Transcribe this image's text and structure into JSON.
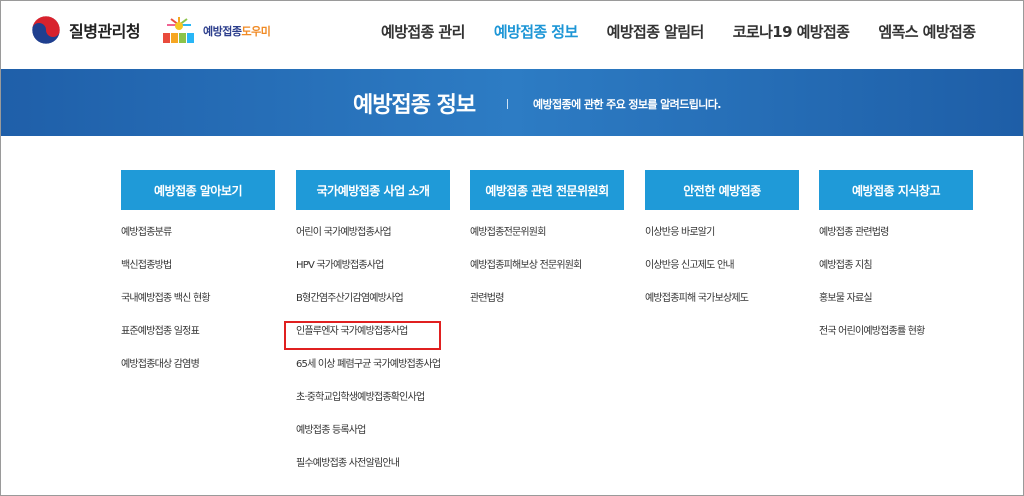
{
  "header": {
    "kdca_name": "질병관리청",
    "nip_name_main": "예방접종",
    "nip_name_accent": "도우미",
    "nav": [
      {
        "label": "예방접종 관리"
      },
      {
        "label": "예방접종 정보"
      },
      {
        "label": "예방접종 알림터"
      },
      {
        "label": "코로나19 예방접종"
      },
      {
        "label": "엠폭스 예방접종"
      }
    ],
    "active_index": 1
  },
  "banner": {
    "title": "예방접종 정보",
    "description": "예방접종에 관한 주요 정보를 알려드립니다."
  },
  "columns": [
    {
      "title": "예방접종 알아보기",
      "items": [
        "예방접종분류",
        "백신접종방법",
        "국내예방접종 백신 현황",
        "표준예방접종 일정표",
        "예방접종대상 감염병"
      ]
    },
    {
      "title": "국가예방접종 사업 소개",
      "items": [
        "어린이 국가예방접종사업",
        "HPV 국가예방접종사업",
        "B형간염주산기감염예방사업",
        "인플루엔자 국가예방접종사업",
        "65세 이상 폐렴구균 국가예방접종사업",
        "초·중학교입학생예방접종확인사업",
        "예방접종 등록사업",
        "필수예방접종 사전알림안내"
      ]
    },
    {
      "title": "예방접종 관련 전문위원회",
      "items": [
        "예방접종전문위원회",
        "예방접종피해보상 전문위원회",
        "관련법령"
      ]
    },
    {
      "title": "안전한 예방접종",
      "items": [
        "이상반응 바로알기",
        "이상반응 신고제도 안내",
        "예방접종피해 국가보상제도"
      ]
    },
    {
      "title": "예방접종 지식창고",
      "items": [
        "예방접종 관련법령",
        "예방접종 지침",
        "홍보물 자료실",
        "전국 어린이예방접종률 현황"
      ]
    }
  ],
  "colors": {
    "brand_blue": "#1f9ad8",
    "banner_blue": "#2d7cc4",
    "nav_active": "#1d96d6",
    "highlight": "#e02020"
  }
}
